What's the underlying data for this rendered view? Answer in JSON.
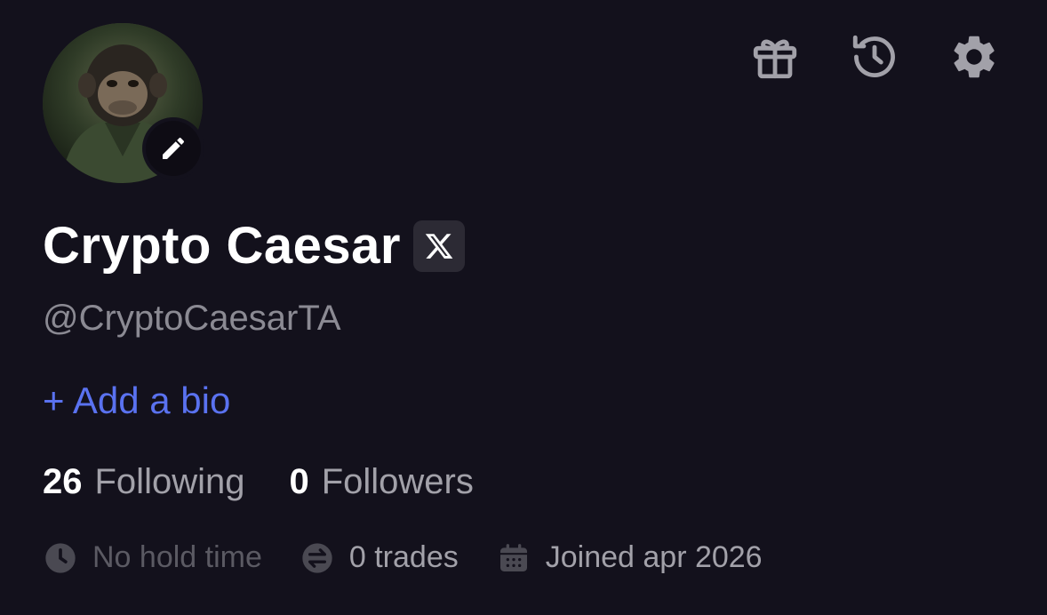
{
  "profile": {
    "name": "Crypto Caesar",
    "handle": "@CryptoCaesarTA",
    "add_bio_label": "+ Add a bio"
  },
  "stats": {
    "following_count": "26",
    "following_label": "Following",
    "followers_count": "0",
    "followers_label": "Followers"
  },
  "meta": {
    "hold_time": "No hold time",
    "trades": "0 trades",
    "joined": "Joined apr 2026"
  },
  "icons": {
    "top": [
      "gift-icon",
      "history-icon",
      "gear-icon"
    ],
    "meta": [
      "clock-icon",
      "swap-icon",
      "calendar-icon"
    ],
    "edit": "pencil-icon",
    "social": "x-logo-icon"
  },
  "colors": {
    "background": "#13111c",
    "accent": "#5a72f0",
    "muted": "#a2a1a9",
    "dim": "#5b5a63"
  }
}
